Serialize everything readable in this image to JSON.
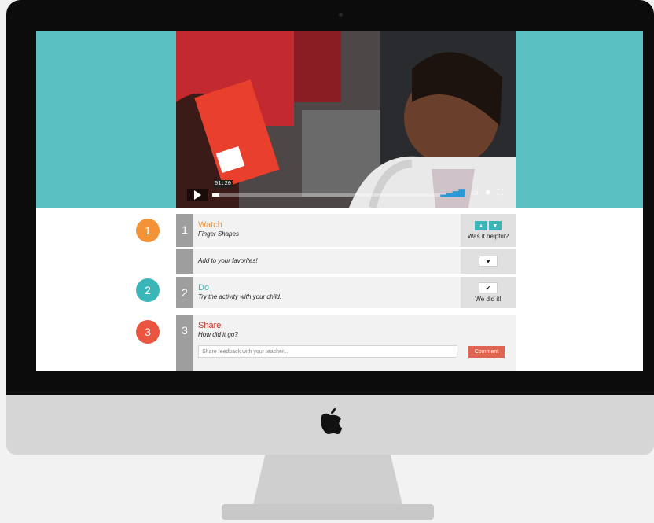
{
  "video": {
    "timecode": "01:20",
    "progress_fraction": 0.03,
    "icons": [
      "play-icon",
      "volume-icon",
      "captions-icon",
      "settings-icon",
      "fullscreen-icon"
    ]
  },
  "steps": [
    {
      "bubble": "1",
      "number": "1",
      "title": "Watch",
      "subtitle": "Finger Shapes",
      "color": "#f39237",
      "feedback": "Was it helpful?"
    },
    {
      "favorite_text": "Add to your favorites!"
    },
    {
      "bubble": "2",
      "number": "2",
      "title": "Do",
      "subtitle": "Try the activity with your child.",
      "color": "#3ab5b8",
      "action_label": "We did it!"
    },
    {
      "bubble": "3",
      "number": "3",
      "title": "Share",
      "subtitle": "How did it go?",
      "color": "#c0392b",
      "input_placeholder": "Share feedback with your teacher...",
      "button_label": "Comment"
    }
  ],
  "colors": {
    "teal_background": "#5bc0c1",
    "comment_button": "#e06451"
  }
}
